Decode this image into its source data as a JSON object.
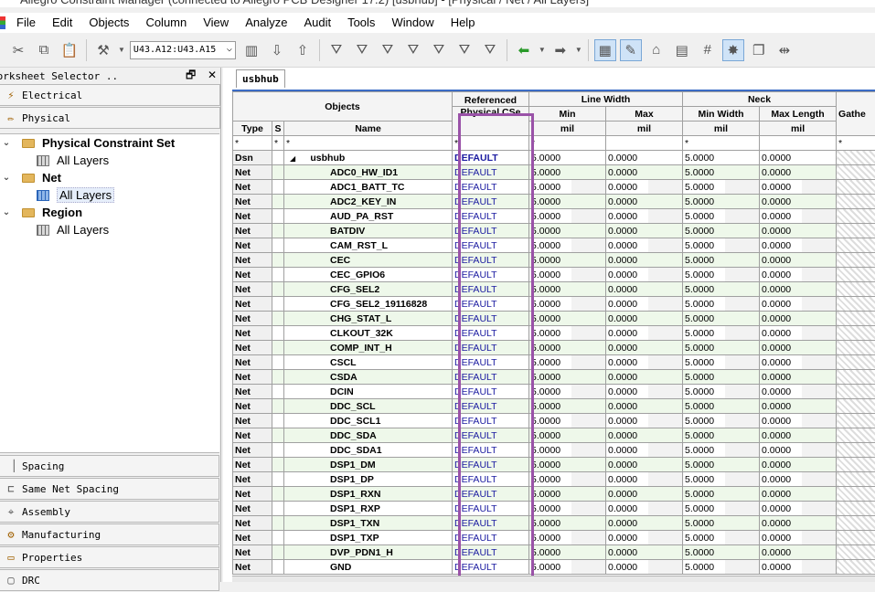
{
  "window": {
    "title": "Allegro Constraint Manager (connected to Allegro PCB Designer 17.2) [usbhub] - [Physical / Net / All Layers]"
  },
  "menu": [
    "File",
    "Edit",
    "Objects",
    "Column",
    "View",
    "Analyze",
    "Audit",
    "Tools",
    "Window",
    "Help"
  ],
  "toolbar": {
    "combo_value": "U43.A12:U43.A15"
  },
  "worksheet_selector": {
    "title": "Worksheet Selector ..",
    "pin": "🗗",
    "close": "✕",
    "top_tabs": [
      {
        "label": "Electrical",
        "icon": "lightning-icon"
      },
      {
        "label": "Physical",
        "icon": "pencil-icon"
      }
    ],
    "tree": {
      "folders": [
        {
          "label": "Physical Constraint Set",
          "child": "All Layers"
        },
        {
          "label": "Net",
          "child": "All Layers"
        },
        {
          "label": "Region",
          "child": "All Layers"
        }
      ]
    },
    "bottom_tabs": [
      {
        "label": "Spacing",
        "icon": "spacing-icon"
      },
      {
        "label": "Same Net Spacing",
        "icon": "same-net-icon"
      },
      {
        "label": "Assembly",
        "icon": "assembly-icon"
      },
      {
        "label": "Manufacturing",
        "icon": "manufacturing-icon"
      },
      {
        "label": "Properties",
        "icon": "properties-icon"
      },
      {
        "label": "DRC",
        "icon": "drc-icon"
      }
    ]
  },
  "doc_tab": "usbhub",
  "grid": {
    "headers": {
      "objects": "Objects",
      "referenced": "Referenced",
      "physical_cset": "Physical CSe",
      "line_width": "Line Width",
      "neck": "Neck",
      "type": "Type",
      "s": "S",
      "name": "Name",
      "min": "Min",
      "max": "Max",
      "min_width": "Min Width",
      "max_length": "Max Length",
      "gather": "Gathe",
      "unit": "mil"
    },
    "filter": "*",
    "rows": [
      {
        "type": "Dsn",
        "name": "usbhub",
        "cset": "DEFAULT",
        "min": "5.0000",
        "max": "0.0000",
        "neck_min": "5.0000",
        "neck_max": "0.0000"
      },
      {
        "type": "Net",
        "name": "ADC0_HW_ID1",
        "cset": "DEFAULT",
        "min": "5.0000",
        "max": "0.0000",
        "neck_min": "5.0000",
        "neck_max": "0.0000"
      },
      {
        "type": "Net",
        "name": "ADC1_BATT_TC",
        "cset": "DEFAULT",
        "min": "5.0000",
        "max": "0.0000",
        "neck_min": "5.0000",
        "neck_max": "0.0000"
      },
      {
        "type": "Net",
        "name": "ADC2_KEY_IN",
        "cset": "DEFAULT",
        "min": "5.0000",
        "max": "0.0000",
        "neck_min": "5.0000",
        "neck_max": "0.0000"
      },
      {
        "type": "Net",
        "name": "AUD_PA_RST",
        "cset": "DEFAULT",
        "min": "5.0000",
        "max": "0.0000",
        "neck_min": "5.0000",
        "neck_max": "0.0000"
      },
      {
        "type": "Net",
        "name": "BATDIV",
        "cset": "DEFAULT",
        "min": "5.0000",
        "max": "0.0000",
        "neck_min": "5.0000",
        "neck_max": "0.0000"
      },
      {
        "type": "Net",
        "name": "CAM_RST_L",
        "cset": "DEFAULT",
        "min": "5.0000",
        "max": "0.0000",
        "neck_min": "5.0000",
        "neck_max": "0.0000"
      },
      {
        "type": "Net",
        "name": "CEC",
        "cset": "DEFAULT",
        "min": "5.0000",
        "max": "0.0000",
        "neck_min": "5.0000",
        "neck_max": "0.0000"
      },
      {
        "type": "Net",
        "name": "CEC_GPIO6",
        "cset": "DEFAULT",
        "min": "5.0000",
        "max": "0.0000",
        "neck_min": "5.0000",
        "neck_max": "0.0000"
      },
      {
        "type": "Net",
        "name": "CFG_SEL2",
        "cset": "DEFAULT",
        "min": "5.0000",
        "max": "0.0000",
        "neck_min": "5.0000",
        "neck_max": "0.0000"
      },
      {
        "type": "Net",
        "name": "CFG_SEL2_19116828",
        "cset": "DEFAULT",
        "min": "5.0000",
        "max": "0.0000",
        "neck_min": "5.0000",
        "neck_max": "0.0000"
      },
      {
        "type": "Net",
        "name": "CHG_STAT_L",
        "cset": "DEFAULT",
        "min": "5.0000",
        "max": "0.0000",
        "neck_min": "5.0000",
        "neck_max": "0.0000"
      },
      {
        "type": "Net",
        "name": "CLKOUT_32K",
        "cset": "DEFAULT",
        "min": "5.0000",
        "max": "0.0000",
        "neck_min": "5.0000",
        "neck_max": "0.0000"
      },
      {
        "type": "Net",
        "name": "COMP_INT_H",
        "cset": "DEFAULT",
        "min": "5.0000",
        "max": "0.0000",
        "neck_min": "5.0000",
        "neck_max": "0.0000"
      },
      {
        "type": "Net",
        "name": "CSCL",
        "cset": "DEFAULT",
        "min": "5.0000",
        "max": "0.0000",
        "neck_min": "5.0000",
        "neck_max": "0.0000"
      },
      {
        "type": "Net",
        "name": "CSDA",
        "cset": "DEFAULT",
        "min": "5.0000",
        "max": "0.0000",
        "neck_min": "5.0000",
        "neck_max": "0.0000"
      },
      {
        "type": "Net",
        "name": "DCIN",
        "cset": "DEFAULT",
        "min": "5.0000",
        "max": "0.0000",
        "neck_min": "5.0000",
        "neck_max": "0.0000"
      },
      {
        "type": "Net",
        "name": "DDC_SCL",
        "cset": "DEFAULT",
        "min": "5.0000",
        "max": "0.0000",
        "neck_min": "5.0000",
        "neck_max": "0.0000"
      },
      {
        "type": "Net",
        "name": "DDC_SCL1",
        "cset": "DEFAULT",
        "min": "5.0000",
        "max": "0.0000",
        "neck_min": "5.0000",
        "neck_max": "0.0000"
      },
      {
        "type": "Net",
        "name": "DDC_SDA",
        "cset": "DEFAULT",
        "min": "5.0000",
        "max": "0.0000",
        "neck_min": "5.0000",
        "neck_max": "0.0000"
      },
      {
        "type": "Net",
        "name": "DDC_SDA1",
        "cset": "DEFAULT",
        "min": "5.0000",
        "max": "0.0000",
        "neck_min": "5.0000",
        "neck_max": "0.0000"
      },
      {
        "type": "Net",
        "name": "DSP1_DM",
        "cset": "DEFAULT",
        "min": "5.0000",
        "max": "0.0000",
        "neck_min": "5.0000",
        "neck_max": "0.0000"
      },
      {
        "type": "Net",
        "name": "DSP1_DP",
        "cset": "DEFAULT",
        "min": "5.0000",
        "max": "0.0000",
        "neck_min": "5.0000",
        "neck_max": "0.0000"
      },
      {
        "type": "Net",
        "name": "DSP1_RXN",
        "cset": "DEFAULT",
        "min": "5.0000",
        "max": "0.0000",
        "neck_min": "5.0000",
        "neck_max": "0.0000"
      },
      {
        "type": "Net",
        "name": "DSP1_RXP",
        "cset": "DEFAULT",
        "min": "5.0000",
        "max": "0.0000",
        "neck_min": "5.0000",
        "neck_max": "0.0000"
      },
      {
        "type": "Net",
        "name": "DSP1_TXN",
        "cset": "DEFAULT",
        "min": "5.0000",
        "max": "0.0000",
        "neck_min": "5.0000",
        "neck_max": "0.0000"
      },
      {
        "type": "Net",
        "name": "DSP1_TXP",
        "cset": "DEFAULT",
        "min": "5.0000",
        "max": "0.0000",
        "neck_min": "5.0000",
        "neck_max": "0.0000"
      },
      {
        "type": "Net",
        "name": "DVP_PDN1_H",
        "cset": "DEFAULT",
        "min": "5.0000",
        "max": "0.0000",
        "neck_min": "5.0000",
        "neck_max": "0.0000"
      },
      {
        "type": "Net",
        "name": "GND",
        "cset": "DEFAULT",
        "min": "5.0000",
        "max": "0.0000",
        "neck_min": "5.0000",
        "neck_max": "0.0000"
      }
    ]
  },
  "colors": {
    "highlight_box": "#9a52a8",
    "row_alt": "#eef8ea",
    "tab_accent": "#3b6cc5"
  }
}
